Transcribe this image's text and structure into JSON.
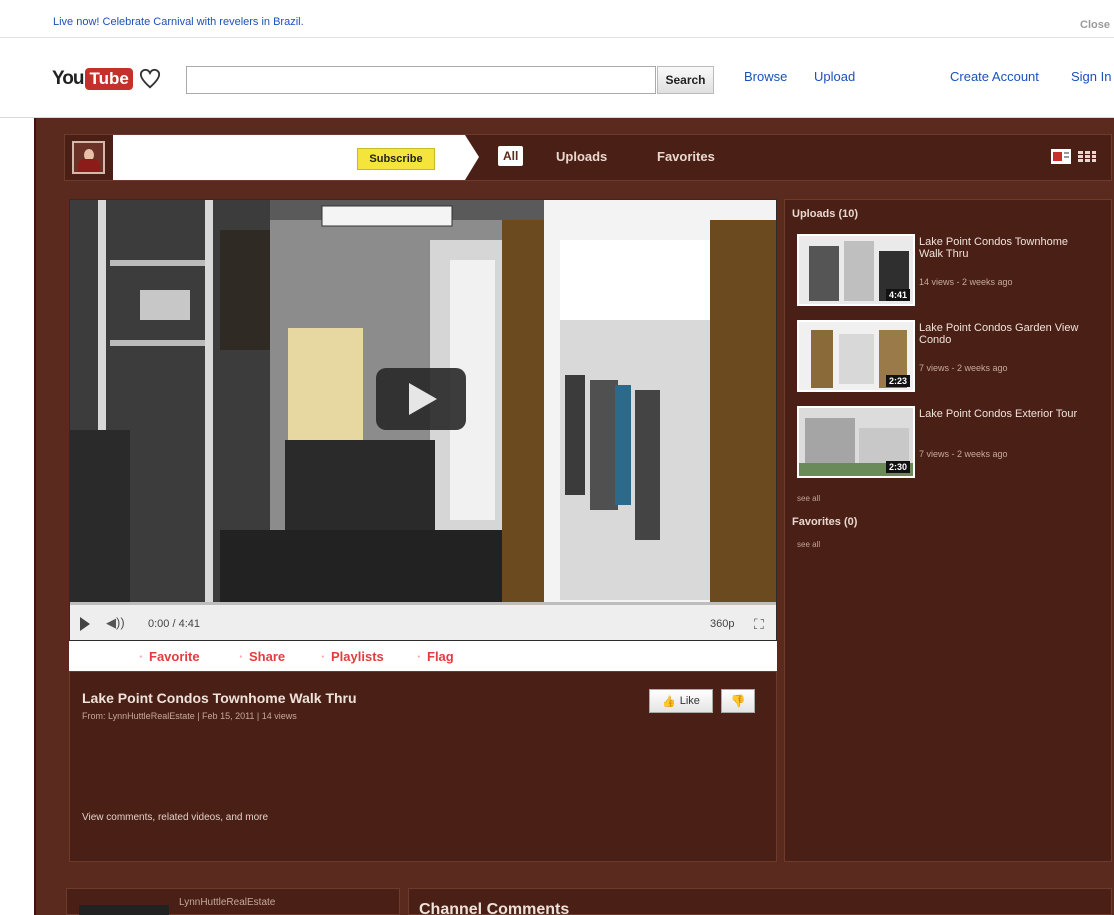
{
  "banner": {
    "promo": "Live now! Celebrate Carnival with revelers in Brazil.",
    "close": "Close"
  },
  "header": {
    "logo_you": "You",
    "logo_tube": "Tube",
    "search_value": "",
    "search_button": "Search",
    "links": [
      "Browse",
      "Upload",
      "Create Account",
      "Sign In"
    ]
  },
  "channel": {
    "subscribe": "Subscribe",
    "tabs": [
      "All",
      "Uploads",
      "Favorites"
    ]
  },
  "player": {
    "time": "0:00 / 4:41",
    "quality": "360p"
  },
  "actions": [
    "Favorite",
    "Share",
    "Playlists",
    "Flag"
  ],
  "video": {
    "title": "Lake Point Condos Townhome Walk Thru",
    "meta": "From: LynnHuttleRealEstate | Feb 15, 2011 | 14 views",
    "like": "Like",
    "more": "View comments, related videos, and more"
  },
  "sidebar": {
    "uploads_header": "Uploads (10)",
    "favorites_header": "Favorites (0)",
    "see_all": "see all",
    "videos": [
      {
        "title": "Lake Point Condos Townhome Walk Thru",
        "views": "14 views - 2 weeks ago",
        "duration": "4:41"
      },
      {
        "title": "Lake Point Condos Garden View Condo",
        "views": "7 views - 2 weeks ago",
        "duration": "2:23"
      },
      {
        "title": "Lake Point Condos Exterior Tour",
        "views": "7 views - 2 weeks ago",
        "duration": "2:30"
      }
    ]
  },
  "bottom": {
    "channel_name": "LynnHuttleRealEstate",
    "comments_title": "Channel Comments"
  },
  "colors": {
    "page_bg": "#5a2a1e",
    "panel_bg": "#4a2016",
    "link_blue": "#1a52b8",
    "action_red": "#e23d3d",
    "subscribe_yellow": "#f4e43c"
  }
}
